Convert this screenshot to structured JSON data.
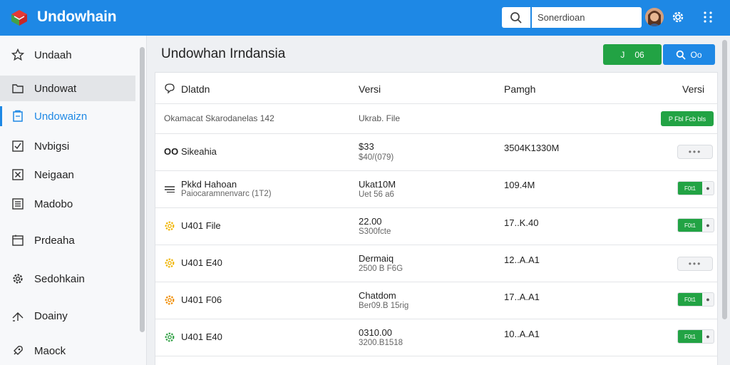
{
  "app": {
    "title": "Undowhain",
    "colors": {
      "primary": "#1e88e5",
      "success": "#22a344"
    }
  },
  "header": {
    "search_placeholder": "Sonerdioan",
    "icons": [
      "search-icon",
      "avatar",
      "gear-icon",
      "apps-grid-icon"
    ]
  },
  "sidebar": {
    "items": [
      {
        "label": "Undaah",
        "icon": "star-icon"
      },
      {
        "label": "Undowat",
        "icon": "folder-icon"
      },
      {
        "label": "Undowaizn",
        "icon": "document-icon"
      },
      {
        "label": "Nvbigsi",
        "icon": "checkbox-icon"
      },
      {
        "label": "Neigaan",
        "icon": "close-box-icon"
      },
      {
        "label": "Madobo",
        "icon": "list-icon"
      },
      {
        "label": "Prdeaha",
        "icon": "window-icon"
      },
      {
        "label": "Sedohkain",
        "icon": "gear-icon"
      },
      {
        "label": "Doainy",
        "icon": "share-icon"
      },
      {
        "label": "Maock",
        "icon": "rocket-icon"
      }
    ]
  },
  "main": {
    "title": "Undowhan Irndansia",
    "green_button": {
      "left": "J",
      "right": "06"
    },
    "blue_button": {
      "label": "Oo"
    },
    "table": {
      "headers": [
        "Dlatdn",
        "Versi",
        "Pamgh",
        "Versi"
      ],
      "summary": {
        "name": "Okamacat Skarodanelas 142",
        "version": "Ukrab. File",
        "action": "P Fbl Fcb bls"
      },
      "rows": [
        {
          "icon": "oo-icon",
          "name": "Sikeahia",
          "ver": "$33",
          "ver2": "$40/(079)",
          "size": "3504K1330M",
          "action": "dots"
        },
        {
          "icon": "equals-icon",
          "name": "Pkkd Hahoan",
          "sub": "Paiocaramnenvarc (1T2)",
          "ver": "Ukat10M",
          "ver2": "Uet 56 a6",
          "size": "109.4M",
          "action": "split"
        },
        {
          "icon": "gear-yellow-icon",
          "name": "U401 File",
          "ver": "22.00",
          "ver2": "S300fcte",
          "size": "17..K.40",
          "action": "split"
        },
        {
          "icon": "gear-yellow-icon",
          "name": "U401 E40",
          "ver": "Dermaiq",
          "ver2": "2500 B F6G",
          "size": "12..A.A1",
          "action": "dots"
        },
        {
          "icon": "gear-orange-icon",
          "name": "U401 F06",
          "ver": "Chatdom",
          "ver2": "Ber09.B 15rig",
          "size": "17..A.A1",
          "action": "split"
        },
        {
          "icon": "gear-green-icon",
          "name": "U401 E40",
          "ver": "0310.00",
          "ver2": "3200.B1518",
          "size": "10..A.A1",
          "action": "split"
        }
      ],
      "split_label": "F0t1",
      "dots_label": "•••"
    }
  }
}
